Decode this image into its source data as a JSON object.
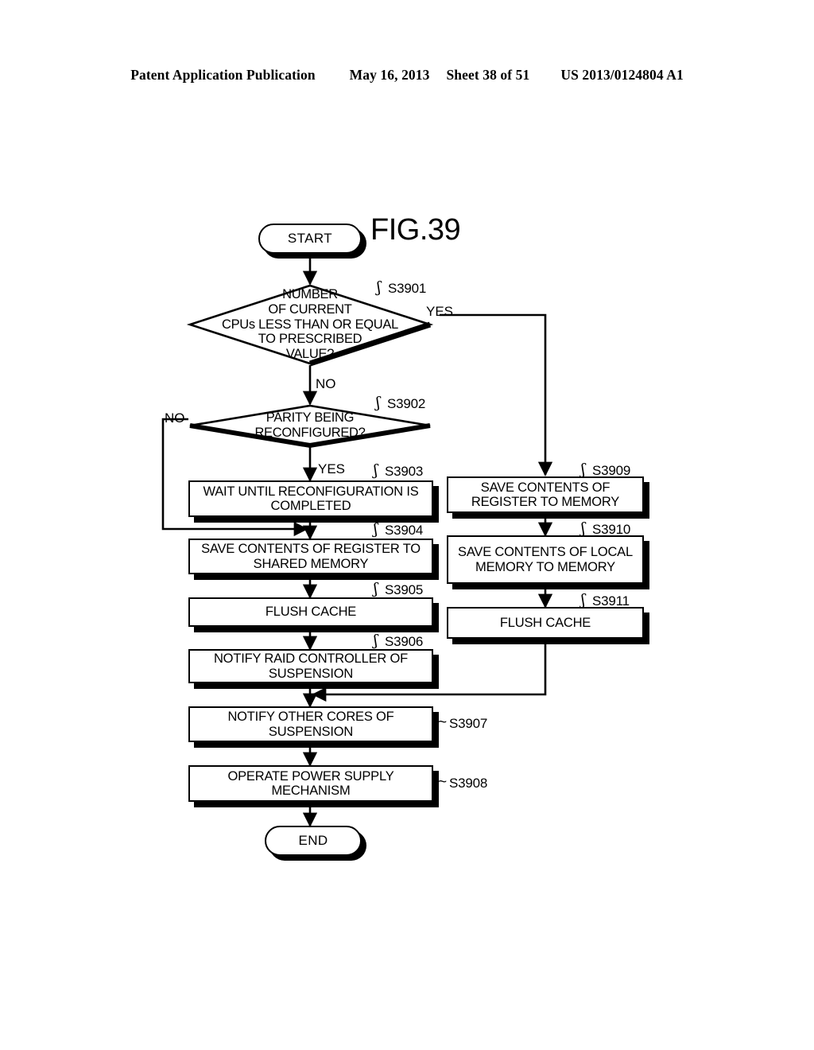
{
  "header": {
    "publication": "Patent Application Publication",
    "date": "May 16, 2013",
    "sheet": "Sheet 38 of 51",
    "docnum": "US 2013/0124804 A1"
  },
  "figure": {
    "title": "FIG.39",
    "start_label": "START",
    "end_label": "END",
    "nodes": [
      {
        "id": "S3901",
        "type": "decision",
        "text": "NUMBER\nOF CURRENT\nCPUs LESS THAN OR EQUAL\nTO PRESCRIBED\nVALUE?",
        "step": "S3901"
      },
      {
        "id": "S3902",
        "type": "decision",
        "text": "PARITY BEING\nRECONFIGURED?",
        "step": "S3902"
      },
      {
        "id": "S3903",
        "type": "process",
        "text": "WAIT UNTIL RECONFIGURATION IS COMPLETED",
        "step": "S3903"
      },
      {
        "id": "S3904",
        "type": "process",
        "text": "SAVE CONTENTS OF REGISTER TO SHARED MEMORY",
        "step": "S3904"
      },
      {
        "id": "S3905",
        "type": "process",
        "text": "FLUSH CACHE",
        "step": "S3905"
      },
      {
        "id": "S3906",
        "type": "process",
        "text": "NOTIFY RAID CONTROLLER OF SUSPENSION",
        "step": "S3906"
      },
      {
        "id": "S3907",
        "type": "process",
        "text": "NOTIFY OTHER CORES OF SUSPENSION",
        "step": "S3907"
      },
      {
        "id": "S3908",
        "type": "process",
        "text": "OPERATE POWER SUPPLY MECHANISM",
        "step": "S3908"
      },
      {
        "id": "S3909",
        "type": "process",
        "text": "SAVE CONTENTS OF REGISTER TO MEMORY",
        "step": "S3909"
      },
      {
        "id": "S3910",
        "type": "process",
        "text": "SAVE CONTENTS OF LOCAL MEMORY TO MEMORY",
        "step": "S3910"
      },
      {
        "id": "S3911",
        "type": "process",
        "text": "FLUSH CACHE",
        "step": "S3911"
      }
    ],
    "branches": {
      "s3901_yes": "YES",
      "s3901_no": "NO",
      "s3902_no": "NO",
      "s3902_yes": "YES"
    }
  }
}
